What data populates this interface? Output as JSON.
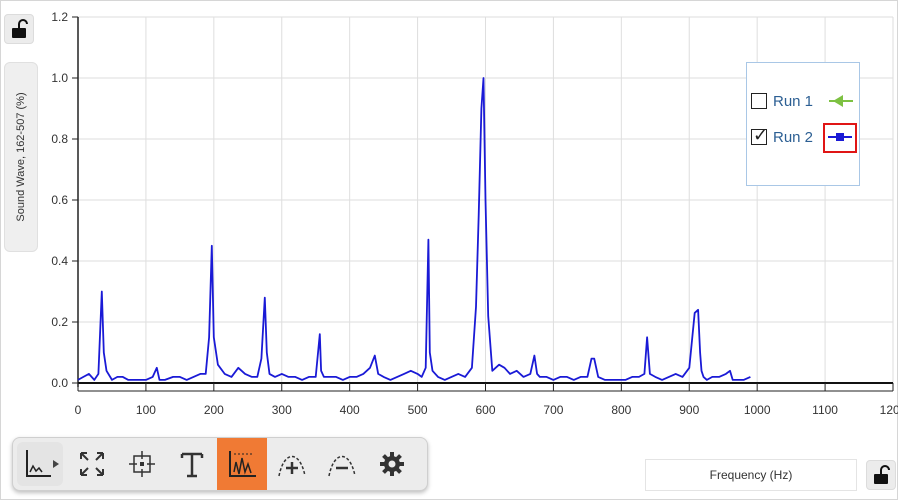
{
  "graph": {
    "y_axis_label": "Sound Wave, 162-507 (%)",
    "x_axis_label": "Frequency (Hz)"
  },
  "legend": {
    "items": [
      {
        "label": "Run 1",
        "checked": false,
        "color": "#7dc142",
        "marker": "triangle-left"
      },
      {
        "label": "Run 2",
        "checked": true,
        "color": "#1a1ad6",
        "marker": "square"
      }
    ]
  },
  "toolbar": {
    "tools": [
      {
        "name": "graph-type",
        "icon": "axes-dropdown-icon"
      },
      {
        "name": "autoscale",
        "icon": "expand-arrows-icon"
      },
      {
        "name": "examine",
        "icon": "crosshair-icon"
      },
      {
        "name": "annotate",
        "icon": "text-T-icon"
      },
      {
        "name": "graph-options",
        "icon": "graph-tool-icon",
        "active": true
      },
      {
        "name": "add-curve-fit",
        "icon": "curve-plus-icon"
      },
      {
        "name": "remove-curve-fit",
        "icon": "curve-minus-icon"
      },
      {
        "name": "settings",
        "icon": "gear-icon"
      }
    ],
    "active_color": "#f07a34"
  },
  "chart_data": {
    "type": "line",
    "xlabel": "Frequency (Hz)",
    "ylabel": "Sound Wave, 162-507 (%)",
    "xlim": [
      0,
      1200
    ],
    "ylim": [
      0,
      1.2
    ],
    "x_ticks": [
      "0",
      "100",
      "200",
      "300",
      "400",
      "500",
      "600",
      "700",
      "800",
      "900",
      "1000",
      "1100",
      "1200"
    ],
    "y_ticks": [
      "0.0",
      "0.2",
      "0.4",
      "0.6",
      "0.8",
      "1.0",
      "1.2"
    ],
    "grid": true,
    "legend_position": "top-right",
    "series": [
      {
        "name": "Run 2",
        "color": "#1a1ad6",
        "x": [
          0,
          8,
          16,
          24,
          30,
          35,
          38,
          42,
          50,
          58,
          66,
          74,
          80,
          90,
          100,
          110,
          116,
          120,
          128,
          140,
          150,
          160,
          170,
          180,
          188,
          193,
          197,
          200,
          206,
          216,
          226,
          236,
          246,
          256,
          264,
          270,
          275,
          278,
          282,
          290,
          300,
          310,
          320,
          330,
          340,
          350,
          356,
          358,
          362,
          370,
          380,
          390,
          400,
          410,
          420,
          430,
          437,
          442,
          450,
          460,
          470,
          480,
          490,
          500,
          506,
          512,
          516,
          518,
          522,
          530,
          540,
          550,
          560,
          570,
          580,
          586,
          590,
          594,
          597,
          600,
          604,
          610,
          620,
          628,
          636,
          646,
          656,
          666,
          672,
          676,
          680,
          690,
          700,
          710,
          720,
          730,
          740,
          750,
          756,
          760,
          766,
          776,
          786,
          796,
          806,
          816,
          826,
          834,
          838,
          842,
          850,
          860,
          870,
          880,
          890,
          900,
          908,
          913,
          916,
          918,
          921,
          926,
          934,
          944,
          954,
          960,
          964,
          970,
          980,
          990
        ],
        "y": [
          0.01,
          0.02,
          0.03,
          0.01,
          0.03,
          0.3,
          0.1,
          0.04,
          0.01,
          0.02,
          0.02,
          0.01,
          0.01,
          0.01,
          0.01,
          0.02,
          0.05,
          0.01,
          0.01,
          0.02,
          0.02,
          0.01,
          0.02,
          0.03,
          0.03,
          0.15,
          0.45,
          0.15,
          0.06,
          0.03,
          0.02,
          0.05,
          0.03,
          0.02,
          0.02,
          0.08,
          0.28,
          0.1,
          0.03,
          0.02,
          0.03,
          0.02,
          0.02,
          0.01,
          0.02,
          0.02,
          0.16,
          0.04,
          0.02,
          0.02,
          0.02,
          0.01,
          0.02,
          0.02,
          0.03,
          0.05,
          0.09,
          0.03,
          0.02,
          0.01,
          0.02,
          0.03,
          0.04,
          0.03,
          0.02,
          0.05,
          0.47,
          0.1,
          0.04,
          0.02,
          0.01,
          0.02,
          0.03,
          0.02,
          0.05,
          0.25,
          0.55,
          0.9,
          1.0,
          0.6,
          0.22,
          0.04,
          0.06,
          0.05,
          0.03,
          0.04,
          0.02,
          0.03,
          0.09,
          0.03,
          0.02,
          0.02,
          0.01,
          0.02,
          0.02,
          0.01,
          0.02,
          0.02,
          0.08,
          0.08,
          0.02,
          0.01,
          0.01,
          0.01,
          0.01,
          0.02,
          0.02,
          0.03,
          0.15,
          0.03,
          0.02,
          0.01,
          0.02,
          0.03,
          0.02,
          0.05,
          0.23,
          0.24,
          0.1,
          0.04,
          0.02,
          0.01,
          0.02,
          0.02,
          0.03,
          0.04,
          0.01,
          0.01,
          0.01,
          0.02
        ]
      }
    ]
  }
}
